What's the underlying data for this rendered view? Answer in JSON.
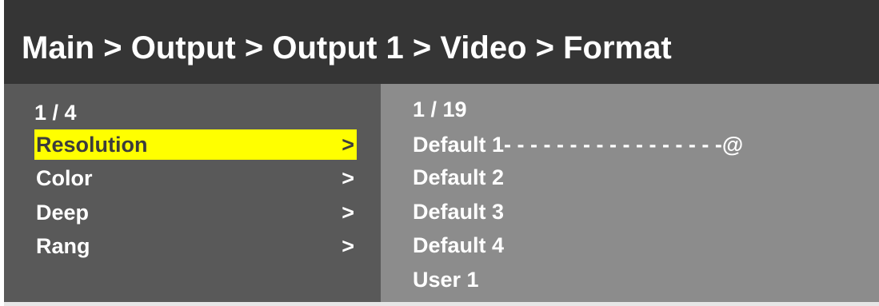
{
  "header": {
    "breadcrumb": "Main > Output > Output 1 > Video > Format"
  },
  "left_panel": {
    "counter": "1 / 4",
    "items": [
      {
        "label": "Resolution",
        "arrow": ">",
        "selected": true
      },
      {
        "label": "Color",
        "arrow": ">",
        "selected": false
      },
      {
        "label": "Deep",
        "arrow": ">",
        "selected": false
      },
      {
        "label": "Rang",
        "arrow": ">",
        "selected": false
      }
    ]
  },
  "right_panel": {
    "counter": "1 / 19",
    "options": [
      {
        "label": "Default 1",
        "dashes": "- - - - - - - - - - - - - - - - -",
        "marker": "@"
      },
      {
        "label": "Default 2"
      },
      {
        "label": "Default 3"
      },
      {
        "label": "Default 4"
      },
      {
        "label": "User 1"
      }
    ]
  },
  "colors": {
    "header_bg": "#353535",
    "left_bg": "#595959",
    "right_bg": "#8c8c8c",
    "highlight": "#ffff00"
  }
}
